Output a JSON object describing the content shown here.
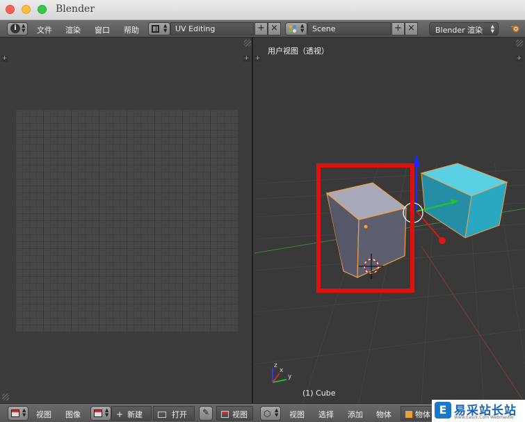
{
  "window": {
    "title": "Blender"
  },
  "top_header": {
    "menus": [
      "文件",
      "渲染",
      "窗口",
      "帮助"
    ],
    "screen_layout": "UV Editing",
    "scene": "Scene",
    "render_engine": "Blender 渲染"
  },
  "viewport": {
    "view_label": "用户视图（透视）",
    "object_label": "(1) Cube",
    "axis_labels": {
      "x": "x",
      "y": "y",
      "z": "z"
    },
    "highlight_color": "#e0100f",
    "selected_outline_color": "#f7a040",
    "second_cube_color": "#2aa8c2"
  },
  "uv_bottom_header": {
    "menus": [
      "视图",
      "图像"
    ],
    "new_label": "新建",
    "open_label": "打开",
    "view_label": "视图"
  },
  "viewport_bottom_header": {
    "menus": [
      "视图",
      "选择",
      "添加",
      "物体"
    ],
    "mode_label": "物体"
  },
  "watermark": {
    "logo": "E",
    "text": "易采站长站",
    "sub": "Www.Easck.Com Webmaster"
  }
}
